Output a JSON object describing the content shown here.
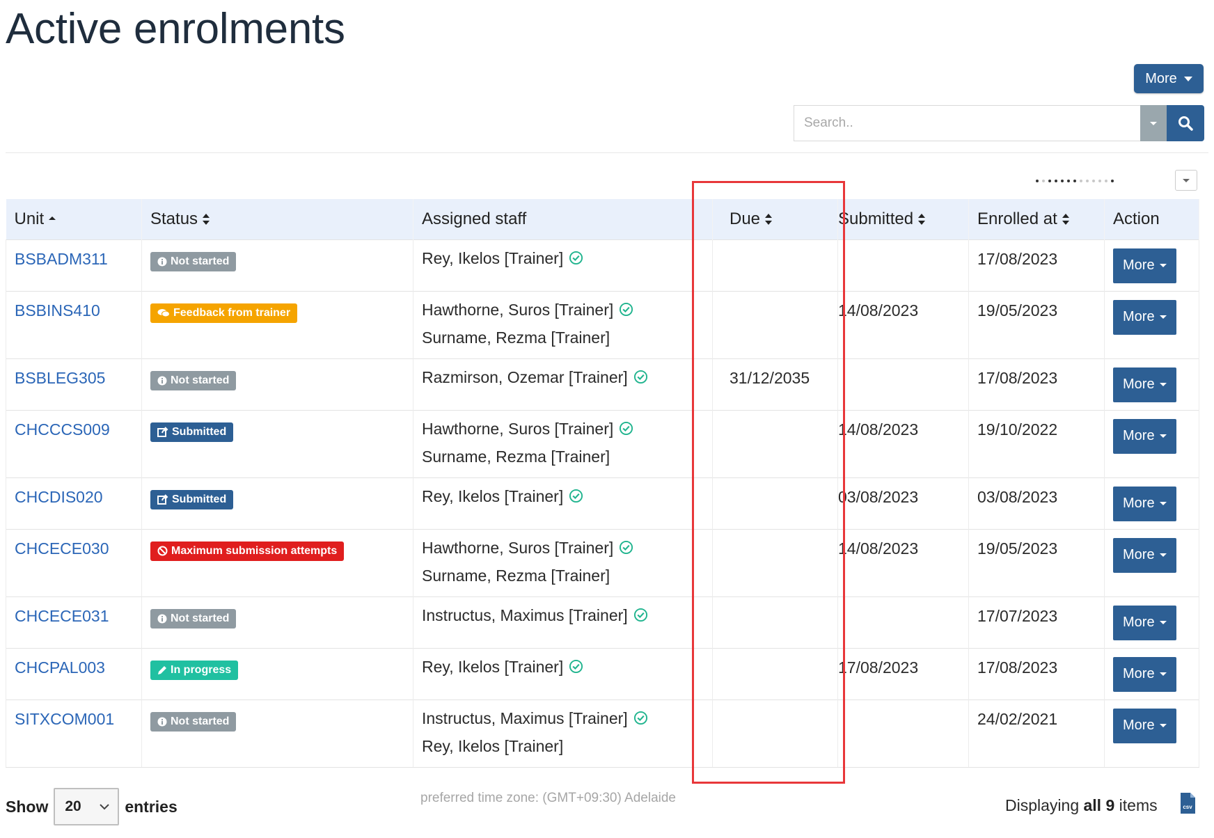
{
  "page": {
    "title": "Active enrolments"
  },
  "toolbar": {
    "more_label": "More"
  },
  "search": {
    "placeholder": "Search.."
  },
  "table": {
    "columns": [
      "Unit",
      "Status",
      "Assigned staff",
      "Due",
      "Submitted",
      "Enrolled at",
      "Action"
    ],
    "rows": [
      {
        "unit": "BSBADM311",
        "status": "Not started",
        "staff": [
          "Rey, Ikelos [Trainer]"
        ],
        "due": "",
        "submitted": "",
        "enrolled": "17/08/2023",
        "action": "More"
      },
      {
        "unit": "BSBINS410",
        "status": "Feedback from trainer",
        "staff": [
          "Hawthorne, Suros [Trainer]",
          "Surname, Rezma [Trainer]"
        ],
        "due": "",
        "submitted": "14/08/2023",
        "enrolled": "19/05/2023",
        "action": "More"
      },
      {
        "unit": "BSBLEG305",
        "status": "Not started",
        "staff": [
          "Razmirson, Ozemar [Trainer]"
        ],
        "due": "31/12/2035",
        "submitted": "",
        "enrolled": "17/08/2023",
        "action": "More"
      },
      {
        "unit": "CHCCCS009",
        "status": "Submitted",
        "staff": [
          "Hawthorne, Suros [Trainer]",
          "Surname, Rezma [Trainer]"
        ],
        "due": "",
        "submitted": "14/08/2023",
        "enrolled": "19/10/2022",
        "action": "More"
      },
      {
        "unit": "CHCDIS020",
        "status": "Submitted",
        "staff": [
          "Rey, Ikelos [Trainer]"
        ],
        "due": "",
        "submitted": "03/08/2023",
        "enrolled": "03/08/2023",
        "action": "More"
      },
      {
        "unit": "CHCECE030",
        "status": "Maximum submission attempts",
        "staff": [
          "Hawthorne, Suros [Trainer]",
          "Surname, Rezma [Trainer]"
        ],
        "due": "",
        "submitted": "14/08/2023",
        "enrolled": "19/05/2023",
        "action": "More"
      },
      {
        "unit": "CHCECE031",
        "status": "Not started",
        "staff": [
          "Instructus, Maximus [Trainer]"
        ],
        "due": "",
        "submitted": "",
        "enrolled": "17/07/2023",
        "action": "More"
      },
      {
        "unit": "CHCPAL003",
        "status": "In progress",
        "staff": [
          "Rey, Ikelos [Trainer]"
        ],
        "due": "",
        "submitted": "17/08/2023",
        "enrolled": "17/08/2023",
        "action": "More"
      },
      {
        "unit": "SITXCOM001",
        "status": "Not started",
        "staff": [
          "Instructus, Maximus [Trainer]",
          "Rey, Ikelos [Trainer]"
        ],
        "due": "",
        "submitted": "",
        "enrolled": "24/02/2021",
        "action": "More"
      }
    ]
  },
  "status_styles": {
    "Not started": {
      "color": "#8f9aa1",
      "icon": "info-icon"
    },
    "Feedback from trainer": {
      "color": "#f5a400",
      "icon": "comments-icon"
    },
    "Submitted": {
      "color": "#2d5f94",
      "icon": "share-icon"
    },
    "Maximum submission attempts": {
      "color": "#e01e1e",
      "icon": "ban-icon"
    },
    "In progress": {
      "color": "#20c0a1",
      "icon": "pencil-icon"
    }
  },
  "footer": {
    "show_label": "Show",
    "page_size": "20",
    "entries_label": "entries",
    "timezone": "preferred time zone: (GMT+09:30) Adelaide",
    "displaying_prefix": "Displaying",
    "displaying_all": "all 9",
    "displaying_suffix": "items",
    "csv_label": "csv"
  },
  "colors": {
    "brand": "#2d5f94",
    "link": "#2b66b7",
    "header_bg": "#e9f0fb",
    "highlight": "#e8373a",
    "verified": "#20b48e"
  }
}
